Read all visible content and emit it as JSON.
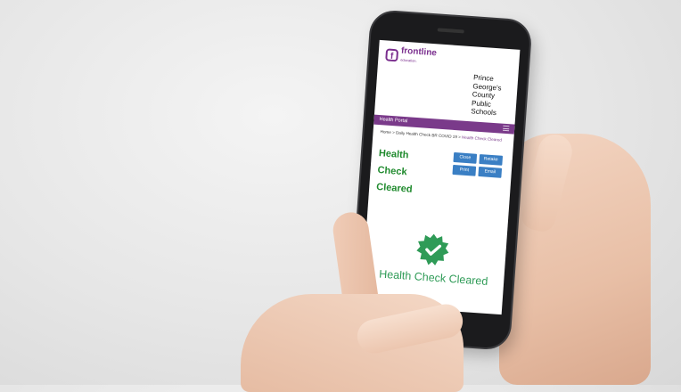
{
  "brand": {
    "logo_letter": "f",
    "logo_name": "frontline",
    "logo_sub": "education."
  },
  "district": {
    "line1": "Prince",
    "line2": "George's",
    "line3": "County",
    "line4": "Public",
    "line5": "Schools"
  },
  "navbar": {
    "title": "Health Portal"
  },
  "breadcrumb": {
    "home": "Home",
    "sep": ">",
    "middle": "Daily Health Check BR COVID 19",
    "current": "Health Check Cleared"
  },
  "status": {
    "line1": "Health",
    "line2": "Check",
    "line3": "Cleared"
  },
  "buttons": {
    "close": "Close",
    "retake": "Retake",
    "print": "Print",
    "email": "Email"
  },
  "message": "Health Check Cleared",
  "colors": {
    "brand_purple": "#7a2e8e",
    "status_green": "#1f8a2d",
    "badge_green": "#2f9b57",
    "button_blue": "#3a7fc4"
  }
}
